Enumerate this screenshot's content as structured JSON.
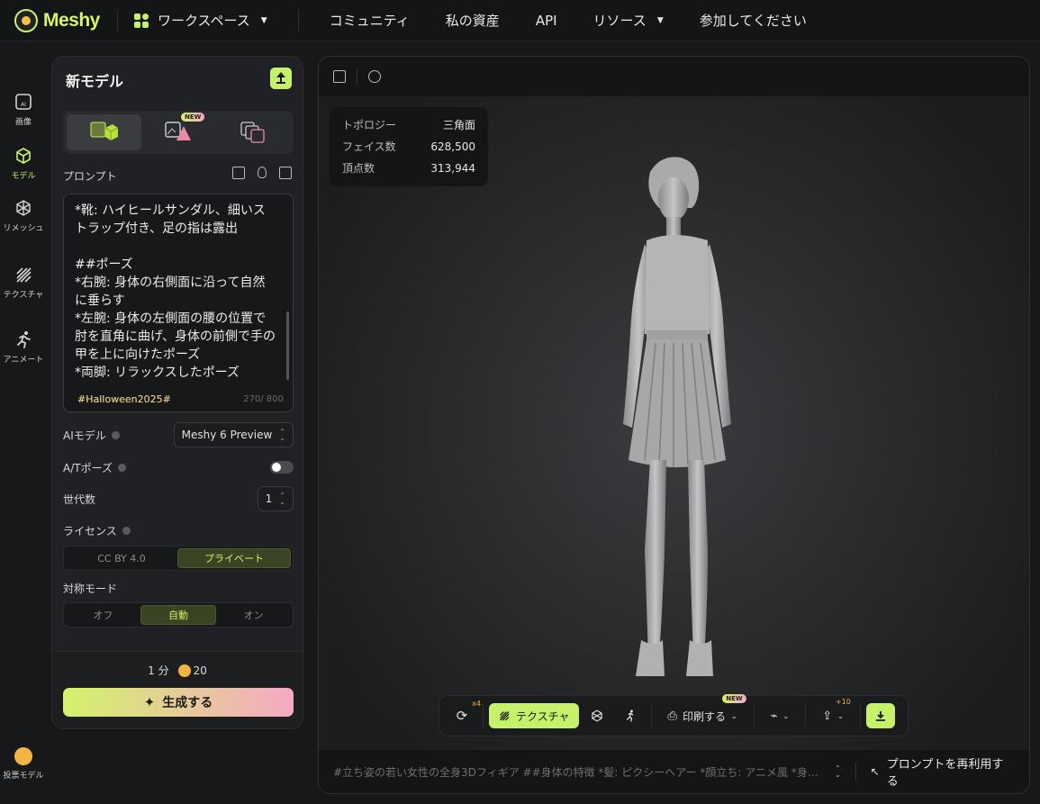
{
  "brand": {
    "name": "Meshy",
    "accent": "#c5f26a"
  },
  "nav": {
    "workspace": "ワークスペース",
    "community": "コミュニティ",
    "assets": "私の資産",
    "api": "API",
    "resources": "リソース",
    "join": "参加してください"
  },
  "rail": {
    "image": "画像",
    "model": "モデル",
    "remesh": "リメッシュ",
    "texture": "テクスチャ",
    "animate": "アニメート",
    "vote": "投票モデル"
  },
  "panel": {
    "title": "新モデル",
    "new_badge": "NEW",
    "prompt_label": "プロンプト",
    "prompt_text": "*靴: ハイヒールサンダル、細いストラップ付き、足の指は露出\n\n##ポーズ\n*右腕: 身体の右側面に沿って自然に垂らす\n*左腕: 身体の左側面の腰の位置で肘を直角に曲げ、身体の前側で手の甲を上に向けたポーズ\n*両脚: リラックスしたポーズ",
    "prompt_tag": "#Halloween2025#",
    "prompt_count": "270/ 800",
    "ai_model_label": "AIモデル",
    "ai_model_value": "Meshy 6 Preview",
    "at_pose_label": "A/Tポーズ",
    "generations_label": "世代数",
    "generations_value": "1",
    "license_label": "ライセンス",
    "license_options": [
      "CC BY 4.0",
      "プライベート"
    ],
    "license_selected": "プライベート",
    "symmetry_label": "対称モード",
    "symmetry_options": [
      "オフ",
      "自動",
      "オン"
    ],
    "symmetry_selected": "自動",
    "time": "1 分",
    "credits": "20",
    "generate": "生成する"
  },
  "viewport": {
    "stats": [
      {
        "k": "トポロジー",
        "v": "三角面"
      },
      {
        "k": "フェイス数",
        "v": "628,500"
      },
      {
        "k": "頂点数",
        "v": "313,944"
      }
    ],
    "toolbar": {
      "refresh_count": "x4",
      "texture": "テクスチャ",
      "print": "印刷する",
      "new_badge": "NEW",
      "share_count": "+10"
    },
    "footer_prompt": "#立ち姿の若い女性の全身3Dフィギア ##身体の特徴 *髪: ピクシーヘアー *顔立ち: アニメ風 *身体: ...",
    "reuse": "プロンプトを再利用する"
  }
}
